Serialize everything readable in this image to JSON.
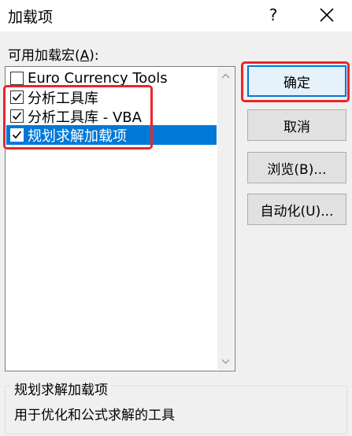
{
  "window": {
    "title": "加载项",
    "help_label": "?"
  },
  "available": {
    "label_prefix": "可用加载宏(",
    "label_key": "A",
    "label_suffix": "):"
  },
  "addins": [
    {
      "label": "Euro Currency Tools",
      "checked": false,
      "selected": false
    },
    {
      "label": "分析工具库",
      "checked": true,
      "selected": false
    },
    {
      "label": "分析工具库 - VBA",
      "checked": true,
      "selected": false
    },
    {
      "label": "规划求解加载项",
      "checked": true,
      "selected": true
    }
  ],
  "buttons": {
    "ok": "确定",
    "cancel": "取消",
    "browse": "浏览(B)...",
    "automation": "自动化(U)..."
  },
  "description": {
    "title": "规划求解加载项",
    "text": "用于优化和公式求解的工具"
  },
  "colors": {
    "selection": "#0078d7",
    "highlight_box": "#e8262c",
    "default_button_border": "#0078d7"
  }
}
